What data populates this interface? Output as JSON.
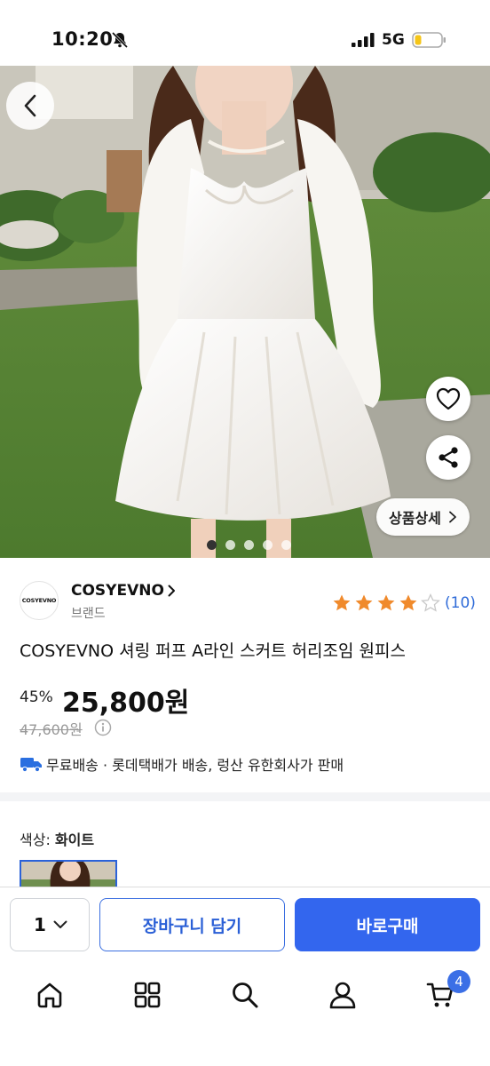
{
  "status_bar": {
    "time": "10:20",
    "network": "5G"
  },
  "hero": {
    "detail_label": "상품상세",
    "dots": 5,
    "active_dot": 0
  },
  "brand": {
    "logo_text": "COSYEVNO",
    "name": "COSYEVNO",
    "sub": "브랜드"
  },
  "rating": {
    "stars": 4,
    "max": 5,
    "count": "(10)"
  },
  "product": {
    "title": "COSYEVNO 셔링 퍼프 A라인 스커트 허리조임 원피스",
    "discount": "45%",
    "price": "25,800원",
    "original_price": "47,600원",
    "shipping": "무료배송 · 롯데택배가 배송, 렁산 유한회사가 판매"
  },
  "options": {
    "color_label": "색상:",
    "color_value": "화이트"
  },
  "buy_bar": {
    "quantity": "1",
    "cart_label": "장바구니 담기",
    "buy_label": "바로구매"
  },
  "tab_bar": {
    "cart_badge": "4"
  },
  "colors": {
    "accent": "#3366ee",
    "star": "#f08a2c",
    "link": "#2f6bd8"
  }
}
